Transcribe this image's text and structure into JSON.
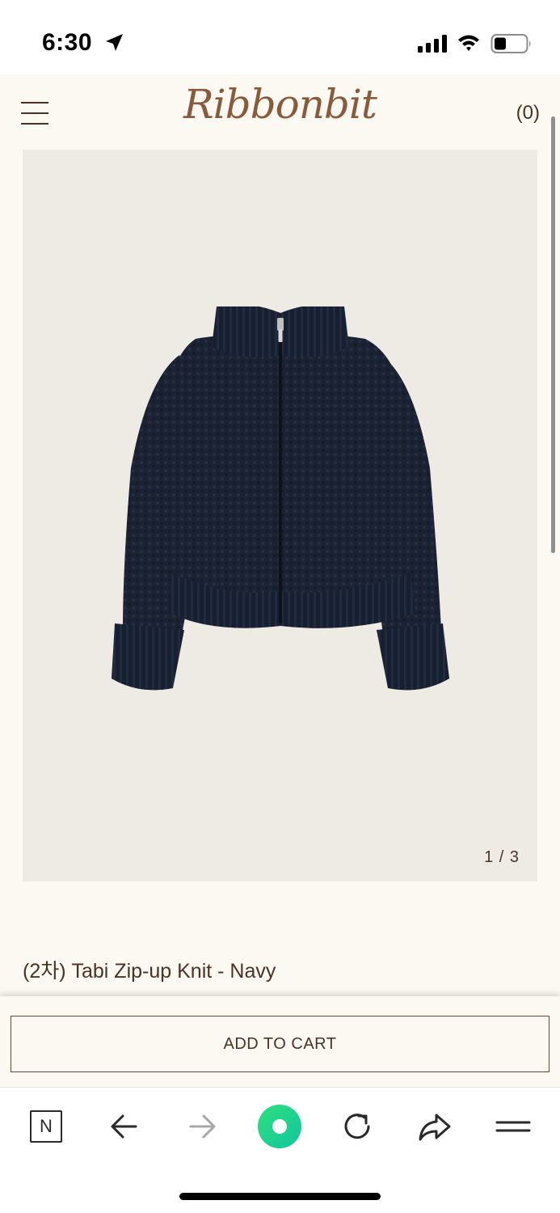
{
  "status_bar": {
    "time": "6:30"
  },
  "header": {
    "brand": "Ribbonbit",
    "cart_count": "(0)"
  },
  "product": {
    "image_counter": "1 / 3",
    "title": "(2차) Tabi Zip-up Knit - Navy"
  },
  "cart": {
    "button_label": "ADD TO CART"
  },
  "browser": {
    "home_letter": "N"
  },
  "colors": {
    "page_bg": "#fbf9f2",
    "image_bg": "#edebe4",
    "text_brown": "#4a3326",
    "logo_brown": "#8a5a3a",
    "sweater_navy": "#1a2233",
    "accent_green": "#1fd18a"
  },
  "icons": [
    "location-arrow-icon",
    "signal-icon",
    "wifi-icon",
    "battery-icon",
    "hamburger-menu-icon",
    "naver-home-icon",
    "back-arrow-icon",
    "forward-arrow-icon",
    "green-circle-icon",
    "reload-icon",
    "share-icon",
    "more-menu-icon"
  ]
}
